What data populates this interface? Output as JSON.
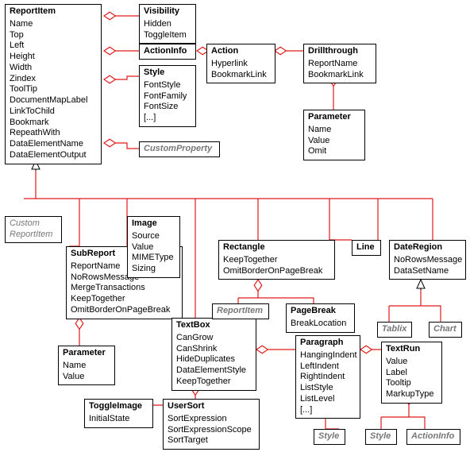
{
  "boxes": {
    "ReportItem": {
      "title": "ReportItem",
      "attrs": [
        "Name",
        "Top",
        "Left",
        "Height",
        "Width",
        "Zindex",
        "ToolTip",
        "DocumentMapLabel",
        "LinkToChild",
        "Bookmark",
        "RepeathWith",
        "DataElementName",
        "DataElementOutput"
      ]
    },
    "Visibility": {
      "title": "Visibility",
      "attrs": [
        "Hidden",
        "ToggleItem"
      ]
    },
    "ActionInfo": {
      "title": "ActionInfo",
      "attrs": []
    },
    "Style": {
      "title": "Style",
      "attrs": [
        "FontStyle",
        "FontFamily",
        "FontSize",
        "[...]"
      ]
    },
    "CustomProperty": {
      "title": "CustomProperty",
      "attrs": []
    },
    "Action": {
      "title": "Action",
      "attrs": [
        "Hyperlink",
        "BookmarkLink"
      ]
    },
    "Drillthrough": {
      "title": "Drillthrough",
      "attrs": [
        "ReportName",
        "BookmarkLink"
      ]
    },
    "ParameterDT": {
      "title": "Parameter",
      "attrs": [
        "Name",
        "Value",
        "Omit"
      ]
    },
    "CustomReportItem": {
      "title": "Custom ReportItem",
      "attrs": []
    },
    "SubReport": {
      "title": "SubReport",
      "attrs": [
        "ReportName",
        "NoRowsMessage",
        "MergeTransactions",
        "KeepTogether",
        "OmitBorderOnPageBreak"
      ]
    },
    "ParameterSR": {
      "title": "Parameter",
      "attrs": [
        "Name",
        "Value"
      ]
    },
    "Image": {
      "title": "Image",
      "attrs": [
        "Source",
        "Value",
        "MIMEType",
        "Sizing"
      ]
    },
    "TextBox": {
      "title": "TextBox",
      "attrs": [
        "CanGrow",
        "CanShrink",
        "HideDuplicates",
        "DataElementStyle",
        "KeepTogether"
      ]
    },
    "ToggleImage": {
      "title": "ToggleImage",
      "attrs": [
        "InitialState"
      ]
    },
    "UserSort": {
      "title": "UserSort",
      "attrs": [
        "SortExpression",
        "SortExpressionScope",
        "SortTarget"
      ]
    },
    "Rectangle": {
      "title": "Rectangle",
      "attrs": [
        "KeepTogether",
        "OmitBorderOnPageBreak"
      ]
    },
    "ReportItemRef": {
      "title": "ReportItem",
      "attrs": []
    },
    "PageBreak": {
      "title": "PageBreak",
      "attrs": [
        "BreakLocation"
      ]
    },
    "Line": {
      "title": "Line",
      "attrs": []
    },
    "DateRegion": {
      "title": "DateRegion",
      "attrs": [
        "NoRowsMessage",
        "DataSetName"
      ]
    },
    "Tablix": {
      "title": "Tablix",
      "attrs": []
    },
    "Chart": {
      "title": "Chart",
      "attrs": []
    },
    "Paragraph": {
      "title": "Paragraph",
      "attrs": [
        "HangingIndent",
        "LeftIndent",
        "RightIndent",
        "ListStyle",
        "ListLevel",
        "[...]"
      ]
    },
    "TextRun": {
      "title": "TextRun",
      "attrs": [
        "Value",
        "Label",
        "Tooltip",
        "MarkupType"
      ]
    },
    "StyleP": {
      "title": "Style",
      "attrs": []
    },
    "StyleT": {
      "title": "Style",
      "attrs": []
    },
    "ActionInfoT": {
      "title": "ActionInfo",
      "attrs": []
    }
  }
}
